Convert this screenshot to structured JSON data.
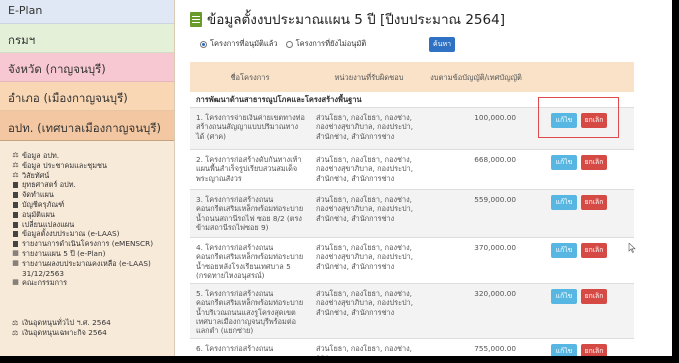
{
  "sidebar": {
    "levels": [
      "E-Plan",
      "กรมฯ",
      "จังหวัด (กาญจนบุรี)",
      "อำเภอ (เมืองกาญจนบุรี)",
      "อปท. (เทศบาลเมืองกาญจนบุรี)"
    ],
    "menu": [
      {
        "icon": "sitemap-icon",
        "label": "ข้อมูล อปท."
      },
      {
        "icon": "sitemap-icon",
        "label": "ข้อมูล ประชาคมและชุมชน"
      },
      {
        "icon": "sitemap-icon",
        "label": "วิสัยทัศน์"
      },
      {
        "icon": "bookmark-icon",
        "label": "ยุทธศาสตร์ อปท."
      },
      {
        "icon": "bookmark-icon",
        "label": "จัดทำแผน"
      },
      {
        "icon": "bookmark-icon",
        "label": "บัญชีครุภัณฑ์"
      },
      {
        "icon": "bookmark-icon",
        "label": "อนุมัติแผน"
      },
      {
        "icon": "bookmark-icon",
        "label": "เปลี่ยนแปลงแผน"
      },
      {
        "icon": "bookmark-icon",
        "label": "ข้อมูลตั้งงบประมาณ (e-LAAS)"
      },
      {
        "icon": "bookmark-icon",
        "label": "รายงานการดำเนินโครงการ (eMENSCR)"
      },
      {
        "icon": "table-icon",
        "label": "รายงานแผน 5 ปี (e-Plan)"
      },
      {
        "icon": "table-icon",
        "label": "รายงานผลงบประมาณคงเหลือ (e-LAAS) 31/12/2563"
      },
      {
        "icon": "table-icon",
        "label": "คณะกรรมการ"
      }
    ],
    "menu_bottom": [
      {
        "icon": "sitemap-icon",
        "label": "เงินอุดหนุนทั่วไป ฯ.ศ. 2564"
      },
      {
        "icon": "sitemap-icon",
        "label": "เงินอุดหนุนเฉพาะกิจ 2564"
      }
    ]
  },
  "main": {
    "title": "ข้อมูลตั้งงบประมาณแผน 5 ปี [ปีงบประมาณ 2564]",
    "filters": {
      "option_approved": "โครงการที่อนุมัติแล้ว",
      "option_not_approved": "โครงการที่ยังไม่อนุมัติ",
      "selected": "option_approved",
      "search_label": "ค้นหา"
    },
    "table": {
      "headers": [
        "ชื่อโครงการ",
        "หน่วยงานที่รับผิดชอบ",
        "งบตามข้อบัญญัติ/เทศบัญญัติ",
        ""
      ],
      "section": "การพัฒนาด้านสาธารณูปโภคและโครงสร้างพื้นฐาน",
      "rows": [
        {
          "name": "1. โครงการจ่ายเงินค่ายเขตทางท่อสร้างถนนสัญญาแบบปริมาณทางได้ (ศาค)",
          "unit": "ส่วนโยธา, กองโยธา, กองช่าง, กองช่างสุขาภิบาล, กองประปา, สำนักช่าง, สำนักการช่าง",
          "budget": "100,000.00"
        },
        {
          "name": "2. โครงการก่อสร้างดับกันทางเท้าแผนพื้นสำเร็จรูปเรียบสวนสมเด็จพระญาณสังวร",
          "unit": "ส่วนโยธา, กองโยธา, กองช่าง, กองช่างสุขาภิบาล, กองประปา, สำนักช่าง, สำนักการช่าง",
          "budget": "668,000.00"
        },
        {
          "name": "3. โครงการก่อสร้างถนนคอนกรีตเสริมเหล็กพร้อมท่อระบายน้ำถนนสถานีรถไฟ ซอย 8/2 (ตรงข้ามสถานีรถไฟซอย 9)",
          "unit": "ส่วนโยธา, กองโยธา, กองช่าง, กองช่างสุขาภิบาล, กองประปา, สำนักช่าง, สำนักการช่าง",
          "budget": "559,000.00"
        },
        {
          "name": "4. โครงการก่อสร้างถนนคอนกรีตเสริมเหล็กพร้อมท่อระบายน้ำซอยหลังโรงเรียนเทศบาล 5 (กรดทายไหงอนุสรณ์)",
          "unit": "ส่วนโยธา, กองโยธา, กองช่าง, กองช่างสุขาภิบาล, กองประปา, สำนักช่าง, สำนักการช่าง",
          "budget": "370,000.00"
        },
        {
          "name": "5. โครงการก่อสร้างถนนคอนกรีตเสริมเหล็กพร้อมท่อระบายน้ำบริเวณถนนแสงรูโครงสุดเขตเทศบาลเมืองกาญจนบุรีพร้อมต่อแลกตำ (แยกซ่าย)",
          "unit": "ส่วนโยธา, กองโยธา, กองช่าง, กองช่างสุขาภิบาล, กองประปา, สำนักช่าง, สำนักการช่าง",
          "budget": "320,000.00"
        },
        {
          "name": "6. โครงการก่อสร้างถนน",
          "unit": "ส่วนโยธา, กองโยธา, กองช่าง, กอง",
          "budget": "755,000.00"
        }
      ],
      "edit_label": "แก้ไข",
      "cancel_label": "ยกเลิก"
    }
  },
  "colors": {
    "edit": "#58b7e2",
    "cancel": "#d64a45",
    "search": "#2f72c4",
    "highlight": "#e04a4a"
  }
}
